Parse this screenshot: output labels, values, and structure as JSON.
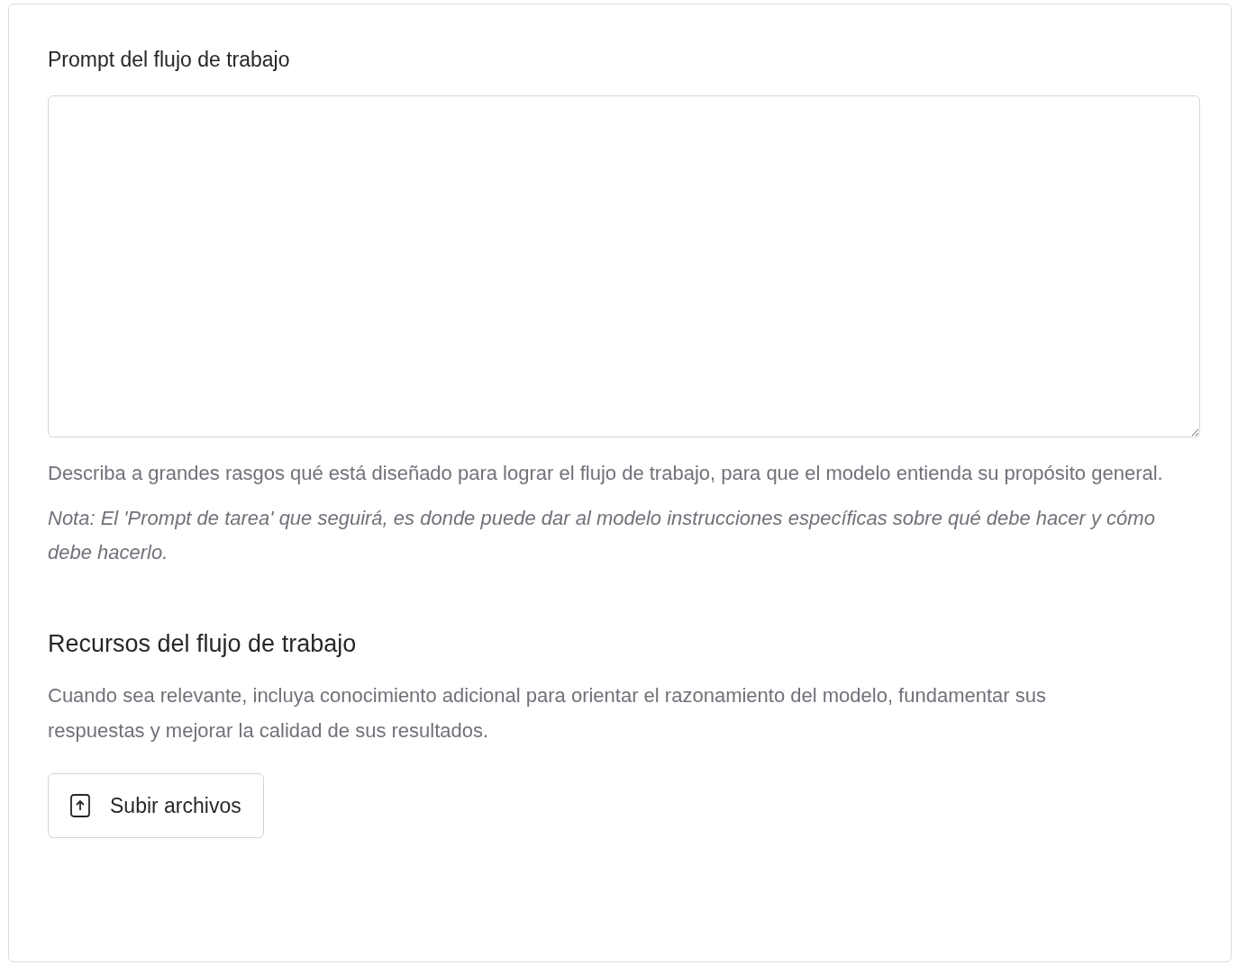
{
  "prompt_section": {
    "label": "Prompt del flujo de trabajo",
    "help": "Describa a grandes rasgos qué está diseñado para lograr el flujo de trabajo, para que el modelo entienda su propósito general.",
    "note": "Nota: El 'Prompt de tarea' que seguirá, es donde puede dar al modelo instrucciones específicas sobre qué debe hacer y cómo debe hacerlo."
  },
  "resources_section": {
    "title": "Recursos del flujo de trabajo",
    "description": "Cuando sea relevante, incluya conocimiento adicional para orientar el razonamiento del modelo, fundamentar sus respuestas y mejorar la calidad de sus resultados.",
    "upload_button": "Subir archivos"
  }
}
